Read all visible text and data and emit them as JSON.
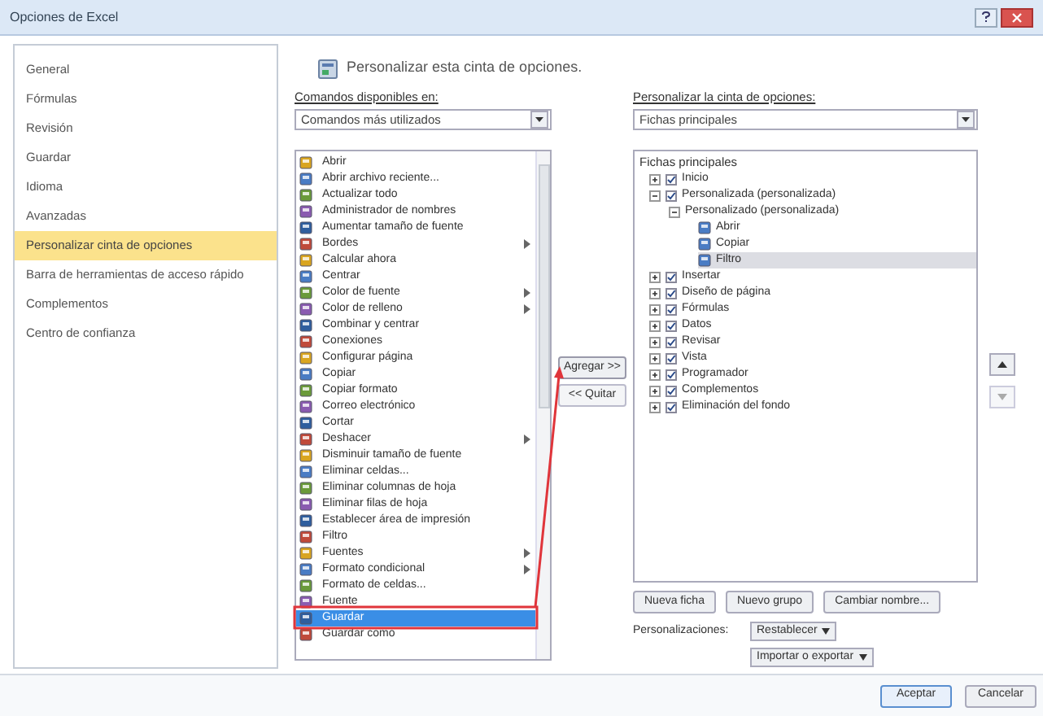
{
  "window": {
    "title": "Opciones de Excel"
  },
  "sidebar": {
    "items": [
      {
        "label": "General",
        "selected": false
      },
      {
        "label": "Fórmulas",
        "selected": false
      },
      {
        "label": "Revisión",
        "selected": false
      },
      {
        "label": "Guardar",
        "selected": false
      },
      {
        "label": "Idioma",
        "selected": false
      },
      {
        "label": "Avanzadas",
        "selected": false
      },
      {
        "label": "Personalizar cinta de opciones",
        "selected": true
      },
      {
        "label": "Barra de herramientas de acceso rápido",
        "selected": false
      },
      {
        "label": "Complementos",
        "selected": false
      },
      {
        "label": "Centro de confianza",
        "selected": false
      }
    ]
  },
  "heading": "Personalizar esta cinta de opciones.",
  "commands": {
    "label": "Comandos disponibles en:",
    "dropdown": "Comandos más utilizados",
    "items": [
      {
        "label": "Abrir",
        "submenu": false,
        "selected": false
      },
      {
        "label": "Abrir archivo reciente...",
        "submenu": false,
        "selected": false
      },
      {
        "label": "Actualizar todo",
        "submenu": false,
        "selected": false
      },
      {
        "label": "Administrador de nombres",
        "submenu": false,
        "selected": false
      },
      {
        "label": "Aumentar tamaño de fuente",
        "submenu": false,
        "selected": false
      },
      {
        "label": "Bordes",
        "submenu": true,
        "selected": false
      },
      {
        "label": "Calcular ahora",
        "submenu": false,
        "selected": false
      },
      {
        "label": "Centrar",
        "submenu": false,
        "selected": false
      },
      {
        "label": "Color de fuente",
        "submenu": true,
        "selected": false
      },
      {
        "label": "Color de relleno",
        "submenu": true,
        "selected": false
      },
      {
        "label": "Combinar y centrar",
        "submenu": false,
        "selected": false
      },
      {
        "label": "Conexiones",
        "submenu": false,
        "selected": false
      },
      {
        "label": "Configurar página",
        "submenu": false,
        "selected": false
      },
      {
        "label": "Copiar",
        "submenu": false,
        "selected": false
      },
      {
        "label": "Copiar formato",
        "submenu": false,
        "selected": false
      },
      {
        "label": "Correo electrónico",
        "submenu": false,
        "selected": false
      },
      {
        "label": "Cortar",
        "submenu": false,
        "selected": false
      },
      {
        "label": "Deshacer",
        "submenu": true,
        "selected": false
      },
      {
        "label": "Disminuir tamaño de fuente",
        "submenu": false,
        "selected": false
      },
      {
        "label": "Eliminar celdas...",
        "submenu": false,
        "selected": false
      },
      {
        "label": "Eliminar columnas de hoja",
        "submenu": false,
        "selected": false
      },
      {
        "label": "Eliminar filas de hoja",
        "submenu": false,
        "selected": false
      },
      {
        "label": "Establecer área de impresión",
        "submenu": false,
        "selected": false
      },
      {
        "label": "Filtro",
        "submenu": false,
        "selected": false
      },
      {
        "label": "Fuentes",
        "submenu": true,
        "selected": false
      },
      {
        "label": "Formato condicional",
        "submenu": true,
        "selected": false
      },
      {
        "label": "Formato de celdas...",
        "submenu": false,
        "selected": false
      },
      {
        "label": "Fuente",
        "submenu": false,
        "selected": false
      },
      {
        "label": "Guardar",
        "submenu": false,
        "selected": true
      },
      {
        "label": "Guardar como",
        "submenu": false,
        "selected": false
      }
    ]
  },
  "add_button": "Agregar >>",
  "remove_button": "<< Quitar",
  "ribbon": {
    "label": "Personalizar la cinta de opciones:",
    "dropdown": "Fichas principales",
    "header": "Fichas principales",
    "tree": [
      {
        "kind": "tab",
        "label": "Inicio",
        "checked": true,
        "expanded": false,
        "selected": false
      },
      {
        "kind": "tab",
        "label": "Personalizada (personalizada)",
        "checked": true,
        "expanded": true,
        "selected": false,
        "children": [
          {
            "kind": "group",
            "label": "Personalizado (personalizada)",
            "expanded": true,
            "selected": false,
            "children": [
              {
                "kind": "command",
                "label": "Abrir",
                "selected": false
              },
              {
                "kind": "command",
                "label": "Copiar",
                "selected": false
              },
              {
                "kind": "command",
                "label": "Filtro",
                "selected": true
              }
            ]
          }
        ]
      },
      {
        "kind": "tab",
        "label": "Insertar",
        "checked": true,
        "expanded": false,
        "selected": false
      },
      {
        "kind": "tab",
        "label": "Diseño de página",
        "checked": true,
        "expanded": false,
        "selected": false
      },
      {
        "kind": "tab",
        "label": "Fórmulas",
        "checked": true,
        "expanded": false,
        "selected": false
      },
      {
        "kind": "tab",
        "label": "Datos",
        "checked": true,
        "expanded": false,
        "selected": false
      },
      {
        "kind": "tab",
        "label": "Revisar",
        "checked": true,
        "expanded": false,
        "selected": false
      },
      {
        "kind": "tab",
        "label": "Vista",
        "checked": true,
        "expanded": false,
        "selected": false
      },
      {
        "kind": "tab",
        "label": "Programador",
        "checked": true,
        "expanded": false,
        "selected": false
      },
      {
        "kind": "tab",
        "label": "Complementos",
        "checked": true,
        "expanded": false,
        "selected": false
      },
      {
        "kind": "tab",
        "label": "Eliminación del fondo",
        "checked": true,
        "expanded": false,
        "selected": false
      }
    ],
    "buttons": [
      "Nueva ficha",
      "Nuevo grupo",
      "Cambiar nombre..."
    ],
    "customizations_label": "Personalizaciones:",
    "reset_button": "Restablecer",
    "import_button": "Importar o exportar"
  },
  "annotation": {
    "kind": "arrow"
  },
  "footer_buttons": [
    "Aceptar",
    "Cancelar"
  ]
}
